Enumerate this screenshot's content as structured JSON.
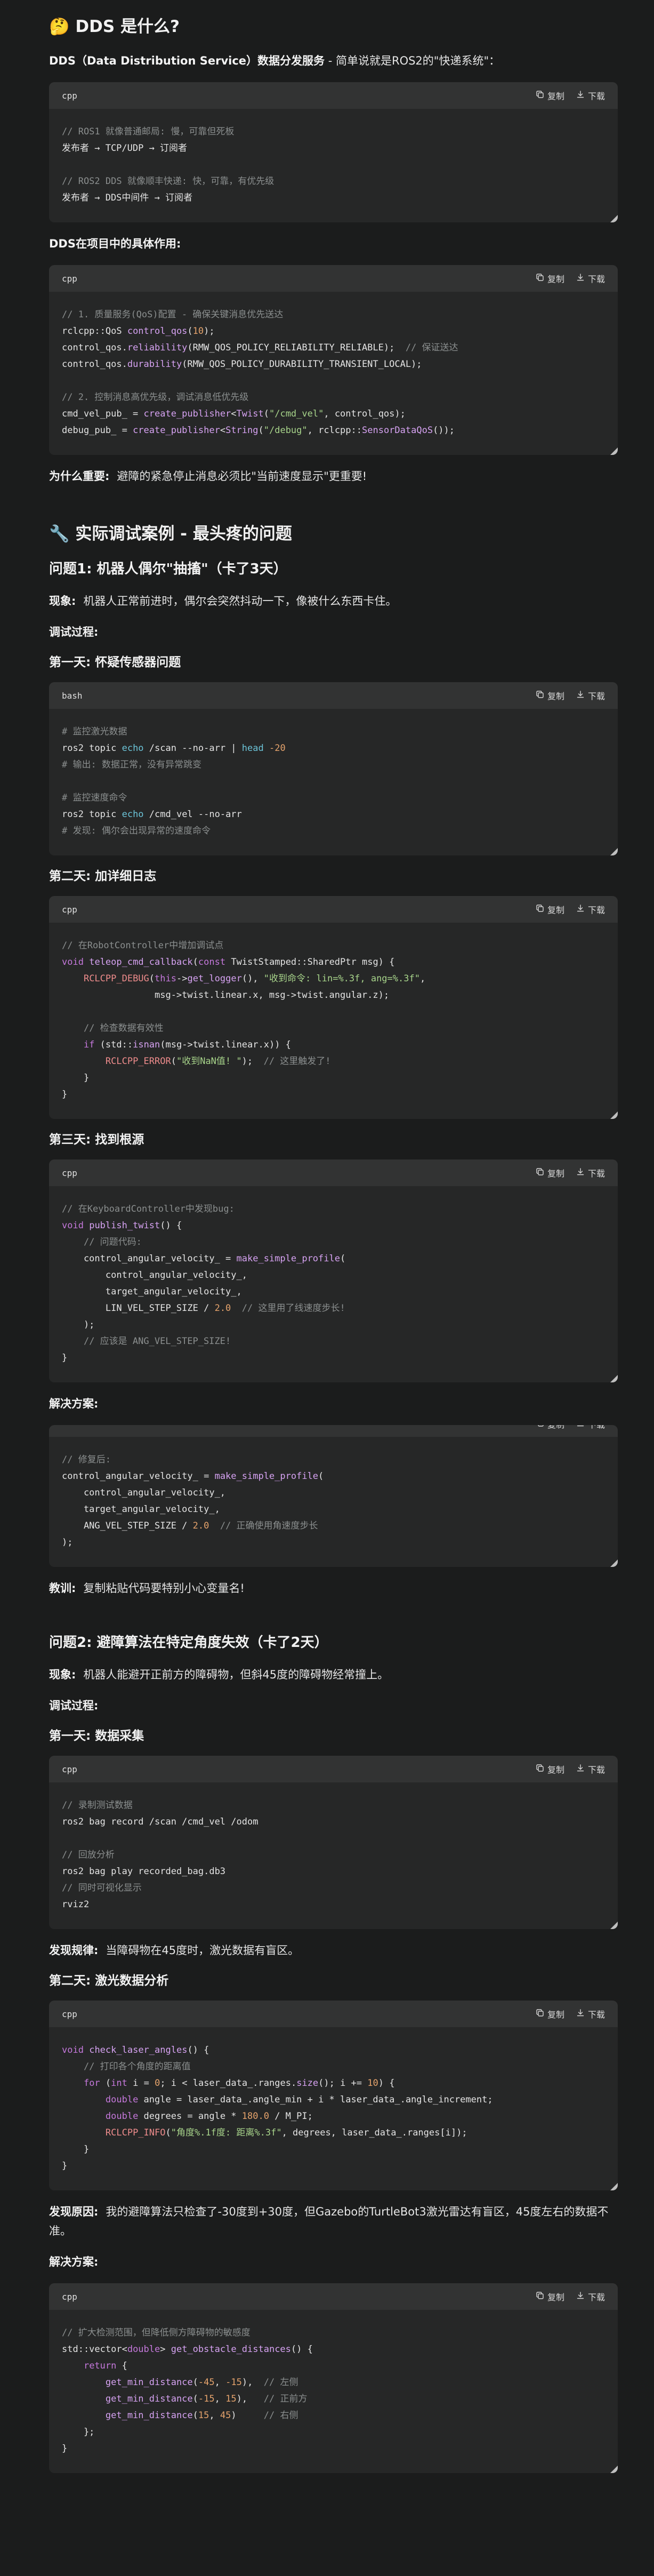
{
  "sections": {
    "s1_title": "🤔 DDS 是什么?",
    "s1_lead_bold": "DDS（Data Distribution Service）数据分发服务",
    "s1_lead_rest": " - 简单说就是ROS2的\"快递系统\"：",
    "s1_usage": "DDS在项目中的具体作用:",
    "s1_why_label": "为什么重要:",
    "s1_why_text": "避障的紧急停止消息必须比\"当前速度显示\"更重要!",
    "s2_title": "🔧 实际调试案例 - 最头疼的问题",
    "p1_title": "问题1: 机器人偶尔\"抽搐\"（卡了3天）",
    "p1_symptom_label": "现象:",
    "p1_symptom_text": "机器人正常前进时，偶尔会突然抖动一下，像被什么东西卡住。",
    "debug_process": "调试过程:",
    "p1_day1": "第一天: 怀疑传感器问题",
    "p1_day2": "第二天: 加详细日志",
    "p1_day3": "第三天: 找到根源",
    "solution": "解决方案:",
    "lesson_label": "教训:",
    "lesson_text": "复制粘贴代码要特别小心变量名!",
    "p2_title": "问题2: 避障算法在特定角度失效（卡了2天）",
    "p2_symptom_label": "现象:",
    "p2_symptom_text": "机器人能避开正前方的障碍物，但斜45度的障碍物经常撞上。",
    "p2_day1": "第一天: 数据采集",
    "p2_found1_label": "发现规律:",
    "p2_found1_text": "当障碍物在45度时，激光数据有盲区。",
    "p2_day2": "第二天: 激光数据分析",
    "p2_found2_label": "发现原因:",
    "p2_found2_text": "我的避障算法只检查了-30度到+30度，但Gazebo的TurtleBot3激光雷达有盲区，45度左右的数据不准。",
    "solution2": "解决方案:"
  },
  "code_ui": {
    "copy_label": "复制",
    "download_label": "下载"
  },
  "code_blocks": {
    "b1": {
      "lang": "cpp",
      "lines": [
        [
          [
            "c",
            "// ROS1 就像普通邮局: 慢，可靠但死板"
          ]
        ],
        [
          [
            "",
            "发布者 → TCP/UDP → 订阅者"
          ]
        ],
        [
          [
            "",
            ""
          ]
        ],
        [
          [
            "c",
            "// ROS2 DDS 就像顺丰快递: 快，可靠，有优先级"
          ]
        ],
        [
          [
            "",
            "发布者 → DDS中间件 → 订阅者"
          ]
        ]
      ]
    },
    "b2": {
      "lang": "cpp",
      "lines": [
        [
          [
            "c",
            "// 1. 质量服务(QoS)配置 - 确保关键消息优先送达"
          ]
        ],
        [
          [
            "",
            "rclcpp::QoS "
          ],
          [
            "f",
            "control_qos"
          ],
          [
            "",
            "("
          ],
          [
            "n",
            "10"
          ],
          [
            "",
            "); "
          ]
        ],
        [
          [
            "",
            "control_qos."
          ],
          [
            "f",
            "reliability"
          ],
          [
            "",
            "(RMW_QOS_POLICY_RELIABILITY_RELIABLE);  "
          ],
          [
            "c",
            "// 保证送达"
          ]
        ],
        [
          [
            "",
            "control_qos."
          ],
          [
            "f",
            "durability"
          ],
          [
            "",
            "(RMW_QOS_POLICY_DURABILITY_TRANSIENT_LOCAL);"
          ]
        ],
        [
          [
            "",
            ""
          ]
        ],
        [
          [
            "c",
            "// 2. 控制消息高优先级，调试消息低优先级"
          ]
        ],
        [
          [
            "",
            "cmd_vel_pub_ = "
          ],
          [
            "f",
            "create_publisher"
          ],
          [
            "",
            "<"
          ],
          [
            "f",
            "Twist"
          ],
          [
            "",
            "("
          ],
          [
            "s",
            "\"/cmd_vel\""
          ],
          [
            "",
            ", control_qos);"
          ]
        ],
        [
          [
            "",
            "debug_pub_ = "
          ],
          [
            "f",
            "create_publisher"
          ],
          [
            "",
            "<"
          ],
          [
            "f",
            "String"
          ],
          [
            "",
            "("
          ],
          [
            "s",
            "\"/debug\""
          ],
          [
            "",
            ", rclcpp::"
          ],
          [
            "f",
            "SensorDataQoS"
          ],
          [
            "",
            "());"
          ]
        ]
      ]
    },
    "b3": {
      "lang": "bash",
      "lines": [
        [
          [
            "c",
            "# 监控激光数据"
          ]
        ],
        [
          [
            "",
            "ros2 topic "
          ],
          [
            "t",
            "echo"
          ],
          [
            "",
            " /scan --no-arr | "
          ],
          [
            "t",
            "head"
          ],
          [
            "",
            " "
          ],
          [
            "n",
            "-20"
          ]
        ],
        [
          [
            "c",
            "# 输出: 数据正常，没有异常跳变"
          ]
        ],
        [
          [
            "",
            ""
          ]
        ],
        [
          [
            "c",
            "# 监控速度命令"
          ]
        ],
        [
          [
            "",
            "ros2 topic "
          ],
          [
            "t",
            "echo"
          ],
          [
            "",
            " /cmd_vel --no-arr"
          ]
        ],
        [
          [
            "c",
            "# 发现: 偶尔会出现异常的速度命令"
          ]
        ]
      ]
    },
    "b4": {
      "lang": "cpp",
      "lines": [
        [
          [
            "c",
            "// 在RobotController中增加调试点"
          ]
        ],
        [
          [
            "k",
            "void"
          ],
          [
            "",
            " "
          ],
          [
            "f",
            "teleop_cmd_callback"
          ],
          [
            "",
            "("
          ],
          [
            "k",
            "const"
          ],
          [
            "",
            " TwistStamped::SharedPtr msg) {"
          ]
        ],
        [
          [
            "",
            "    "
          ],
          [
            "r",
            "RCLCPP_DEBUG"
          ],
          [
            "",
            "("
          ],
          [
            "k",
            "this"
          ],
          [
            "",
            "->"
          ],
          [
            "f",
            "get_logger"
          ],
          [
            "",
            "(), "
          ],
          [
            "s",
            "\"收到命令: lin=%.3f, ang=%.3f\""
          ],
          [
            "",
            ","
          ]
        ],
        [
          [
            "",
            "                 msg->twist.linear.x, msg->twist.angular.z);"
          ]
        ],
        [
          [
            "",
            ""
          ]
        ],
        [
          [
            "",
            "    "
          ],
          [
            "c",
            "// 检查数据有效性"
          ]
        ],
        [
          [
            "",
            "    "
          ],
          [
            "k",
            "if"
          ],
          [
            "",
            " (std::"
          ],
          [
            "f",
            "isnan"
          ],
          [
            "",
            "(msg->twist.linear.x)) {"
          ]
        ],
        [
          [
            "",
            "        "
          ],
          [
            "r",
            "RCLCPP_ERROR"
          ],
          [
            "",
            "("
          ],
          [
            "s",
            "\"收到NaN值! \""
          ],
          [
            "",
            "); "
          ],
          [
            "c",
            " // 这里触发了!"
          ]
        ],
        [
          [
            "",
            "    }"
          ]
        ],
        [
          [
            "",
            "}"
          ]
        ]
      ]
    },
    "b5": {
      "lang": "cpp",
      "lines": [
        [
          [
            "c",
            "// 在KeyboardController中发现bug:"
          ]
        ],
        [
          [
            "k",
            "void"
          ],
          [
            "",
            " "
          ],
          [
            "f",
            "publish_twist"
          ],
          [
            "",
            "() {"
          ]
        ],
        [
          [
            "",
            "    "
          ],
          [
            "c",
            "// 问题代码:"
          ]
        ],
        [
          [
            "",
            "    control_angular_velocity_ = "
          ],
          [
            "f",
            "make_simple_profile"
          ],
          [
            "",
            "("
          ]
        ],
        [
          [
            "",
            "        control_angular_velocity_,"
          ]
        ],
        [
          [
            "",
            "        target_angular_velocity_,"
          ]
        ],
        [
          [
            "",
            "        LIN_VEL_STEP_SIZE / "
          ],
          [
            "n",
            "2.0"
          ],
          [
            "",
            "  "
          ],
          [
            "c",
            "// 这里用了线速度步长!"
          ]
        ],
        [
          [
            "",
            "    );"
          ]
        ],
        [
          [
            "",
            "    "
          ],
          [
            "c",
            "// 应该是 ANG_VEL_STEP_SIZE!"
          ]
        ],
        [
          [
            "",
            "}"
          ]
        ]
      ]
    },
    "b6": {
      "lang": "cpp",
      "lines": [
        [
          [
            "c",
            "// 修复后:"
          ]
        ],
        [
          [
            "",
            "control_angular_velocity_ = "
          ],
          [
            "f",
            "make_simple_profile"
          ],
          [
            "",
            "("
          ]
        ],
        [
          [
            "",
            "    control_angular_velocity_,"
          ]
        ],
        [
          [
            "",
            "    target_angular_velocity_,"
          ]
        ],
        [
          [
            "",
            "    ANG_VEL_STEP_SIZE / "
          ],
          [
            "n",
            "2.0"
          ],
          [
            "",
            "  "
          ],
          [
            "c",
            "// 正确使用角速度步长"
          ]
        ],
        [
          [
            "",
            ");"
          ]
        ]
      ]
    },
    "b7": {
      "lang": "cpp",
      "lines": [
        [
          [
            "c",
            "// 录制测试数据"
          ]
        ],
        [
          [
            "",
            "ros2 bag record /scan /cmd_vel /odom"
          ]
        ],
        [
          [
            "",
            ""
          ]
        ],
        [
          [
            "c",
            "// 回放分析"
          ]
        ],
        [
          [
            "",
            "ros2 bag play recorded_bag.db3"
          ]
        ],
        [
          [
            "c",
            "// 同时可视化显示"
          ]
        ],
        [
          [
            "",
            "rviz2"
          ]
        ]
      ]
    },
    "b8": {
      "lang": "cpp",
      "lines": [
        [
          [
            "k",
            "void"
          ],
          [
            "",
            " "
          ],
          [
            "f",
            "check_laser_angles"
          ],
          [
            "",
            "() {"
          ]
        ],
        [
          [
            "",
            "    "
          ],
          [
            "c",
            "// 打印各个角度的距离值"
          ]
        ],
        [
          [
            "",
            "    "
          ],
          [
            "k",
            "for"
          ],
          [
            "",
            " ("
          ],
          [
            "k",
            "int"
          ],
          [
            "",
            " i = "
          ],
          [
            "n",
            "0"
          ],
          [
            "",
            "; i < laser_data_.ranges."
          ],
          [
            "f",
            "size"
          ],
          [
            "",
            "(); i += "
          ],
          [
            "n",
            "10"
          ],
          [
            "",
            ") {"
          ]
        ],
        [
          [
            "",
            "        "
          ],
          [
            "k",
            "double"
          ],
          [
            "",
            " angle = laser_data_.angle_min + i * laser_data_.angle_increment;"
          ]
        ],
        [
          [
            "",
            "        "
          ],
          [
            "k",
            "double"
          ],
          [
            "",
            " degrees = angle * "
          ],
          [
            "n",
            "180.0"
          ],
          [
            "",
            " / M_PI;"
          ]
        ],
        [
          [
            "",
            "        "
          ],
          [
            "r",
            "RCLCPP_INFO"
          ],
          [
            "",
            "("
          ],
          [
            "s",
            "\"角度%.1f度: 距离%.3f\""
          ],
          [
            "",
            ", degrees, laser_data_.ranges[i]);"
          ]
        ],
        [
          [
            "",
            "    }"
          ]
        ],
        [
          [
            "",
            "}"
          ]
        ]
      ]
    },
    "b9": {
      "lang": "cpp",
      "lines": [
        [
          [
            "c",
            "// 扩大检测范围，但降低侧方障碍物的敏感度"
          ]
        ],
        [
          [
            "",
            "std::vector<"
          ],
          [
            "k",
            "double"
          ],
          [
            "",
            "> "
          ],
          [
            "f",
            "get_obstacle_distances"
          ],
          [
            "",
            "() {"
          ]
        ],
        [
          [
            "",
            "    "
          ],
          [
            "k",
            "return"
          ],
          [
            "",
            " {"
          ]
        ],
        [
          [
            "",
            "        "
          ],
          [
            "f",
            "get_min_distance"
          ],
          [
            "",
            "("
          ],
          [
            "n",
            "-45"
          ],
          [
            "",
            ", "
          ],
          [
            "n",
            "-15"
          ],
          [
            "",
            "),  "
          ],
          [
            "c",
            "// 左侧"
          ]
        ],
        [
          [
            "",
            "        "
          ],
          [
            "f",
            "get_min_distance"
          ],
          [
            "",
            "("
          ],
          [
            "n",
            "-15"
          ],
          [
            "",
            ", "
          ],
          [
            "n",
            "15"
          ],
          [
            "",
            "),   "
          ],
          [
            "c",
            "// 正前方"
          ]
        ],
        [
          [
            "",
            "        "
          ],
          [
            "f",
            "get_min_distance"
          ],
          [
            "",
            "("
          ],
          [
            "n",
            "15"
          ],
          [
            "",
            ", "
          ],
          [
            "n",
            "45"
          ],
          [
            "",
            ")     "
          ],
          [
            "c",
            "// 右侧"
          ]
        ],
        [
          [
            "",
            "    };"
          ]
        ],
        [
          [
            "",
            "}"
          ]
        ]
      ]
    }
  }
}
